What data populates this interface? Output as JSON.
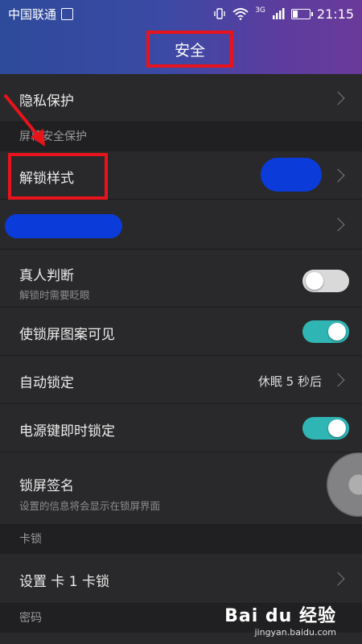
{
  "statusbar": {
    "carrier": "中国联通",
    "network": "3G",
    "time": "21:15"
  },
  "header": {
    "title": "安全"
  },
  "rows": {
    "privacy": {
      "title": "隐私保护"
    },
    "section_lockscreen": "屏幕安全保护",
    "unlock_style": {
      "title": "解锁样式"
    },
    "real_person": {
      "title": "真人判断",
      "subtitle": "解锁时需要眨眼",
      "state": "off"
    },
    "pattern_visible": {
      "title": "使锁屏图案可见",
      "state": "on"
    },
    "auto_lock": {
      "title": "自动锁定",
      "value": "休眠 5 秒后"
    },
    "power_lock": {
      "title": "电源键即时锁定",
      "state": "on"
    },
    "lock_signature": {
      "title": "锁屏签名",
      "subtitle": "设置的信息将会显示在锁屏界面"
    },
    "section_simlock": "卡锁",
    "sim1_lock": {
      "title": "设置 卡 1 卡锁"
    },
    "section_password": "密码"
  },
  "watermark": {
    "logo": "Bai du 经验",
    "url": "jingyan.baidu.com"
  },
  "colors": {
    "accent_toggle": "#2fb5b4",
    "annotation_red": "#e8131b",
    "redaction_blue": "#0b3bd9"
  }
}
